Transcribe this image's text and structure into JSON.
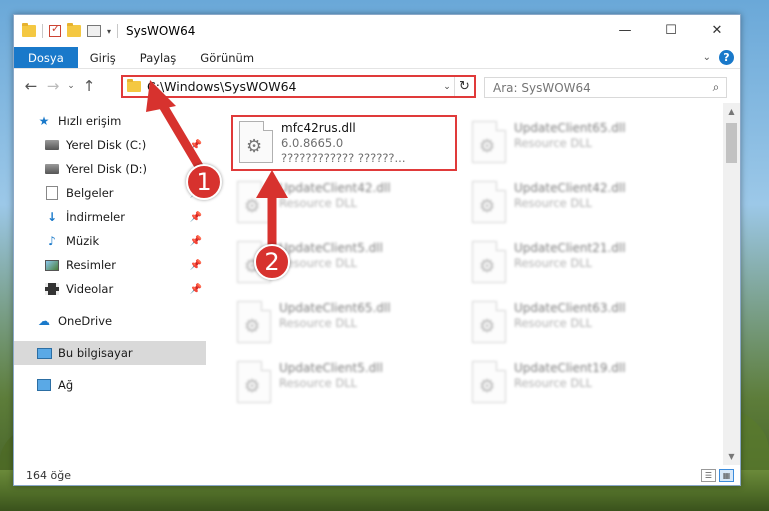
{
  "window": {
    "title": "SysWOW64",
    "controls": {
      "minimize": "—",
      "maximize": "☐",
      "close": "✕"
    }
  },
  "ribbon": {
    "tabs": [
      "Dosya",
      "Giriş",
      "Paylaş",
      "Görünüm"
    ],
    "help": "?"
  },
  "nav": {
    "address": "C:\\Windows\\SysWOW64",
    "search_placeholder": "Ara: SysWOW64"
  },
  "sidebar": {
    "quick_access": "Hızlı erişim",
    "items": [
      {
        "label": "Yerel Disk (C:)",
        "icon": "disk-icon",
        "pinned": true
      },
      {
        "label": "Yerel Disk (D:)",
        "icon": "disk-icon",
        "pinned": false
      },
      {
        "label": "Belgeler",
        "icon": "documents-icon",
        "pinned": true
      },
      {
        "label": "İndirmeler",
        "icon": "downloads-icon",
        "pinned": true
      },
      {
        "label": "Müzik",
        "icon": "music-icon",
        "pinned": true
      },
      {
        "label": "Resimler",
        "icon": "pictures-icon",
        "pinned": true
      },
      {
        "label": "Videolar",
        "icon": "videos-icon",
        "pinned": true
      }
    ],
    "onedrive": "OneDrive",
    "this_pc": "Bu bilgisayar",
    "network": "Ağ"
  },
  "files": [
    {
      "name": "mfc42rus.dll",
      "line2": "6.0.8665.0",
      "line3": "???????????? ??????...",
      "highlight": true
    },
    {
      "name": "UpdateClient65.dll",
      "line2": "Resource DLL"
    },
    {
      "name": "UpdateClient42.dll",
      "line2": "Resource DLL"
    },
    {
      "name": "UpdateClient42.dll",
      "line2": "Resource DLL"
    },
    {
      "name": "UpdateClient5.dll",
      "line2": "Resource DLL"
    },
    {
      "name": "UpdateClient21.dll",
      "line2": "Resource DLL"
    },
    {
      "name": "UpdateClient65.dll",
      "line2": "Resource DLL"
    },
    {
      "name": "UpdateClient63.dll",
      "line2": "Resource DLL"
    },
    {
      "name": "UpdateClient5.dll",
      "line2": "Resource DLL"
    },
    {
      "name": "UpdateClient19.dll",
      "line2": "Resource DLL"
    }
  ],
  "status": {
    "count": "164 öğe"
  },
  "annotations": {
    "marker1": "1",
    "marker2": "2",
    "color": "#d7322e"
  }
}
